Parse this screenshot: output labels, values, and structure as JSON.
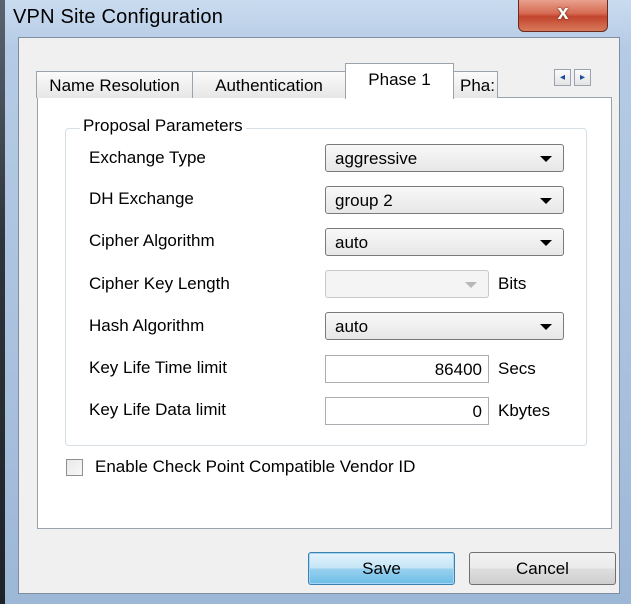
{
  "window": {
    "title": "VPN Site Configuration",
    "close_glyph": "x"
  },
  "tabs": [
    {
      "label": "Name Resolution"
    },
    {
      "label": "Authentication"
    },
    {
      "label": "Phase 1",
      "active": true
    },
    {
      "label": "Pha:"
    }
  ],
  "tab_scroll": {
    "left_icon": "scroll-left-icon",
    "right_icon": "scroll-right-icon"
  },
  "group": {
    "title": "Proposal Parameters"
  },
  "fields": {
    "exchange_type": {
      "label": "Exchange Type",
      "value": "aggressive"
    },
    "dh_exchange": {
      "label": "DH Exchange",
      "value": "group 2"
    },
    "cipher_algorithm": {
      "label": "Cipher Algorithm",
      "value": "auto"
    },
    "cipher_key_length": {
      "label": "Cipher Key Length",
      "value": "",
      "unit": "Bits",
      "disabled": true
    },
    "hash_algorithm": {
      "label": "Hash Algorithm",
      "value": "auto"
    },
    "key_life_time": {
      "label": "Key Life Time limit",
      "value": "86400",
      "unit": "Secs"
    },
    "key_life_data": {
      "label": "Key Life Data limit",
      "value": "0",
      "unit": "Kbytes"
    }
  },
  "vendor_id_checkbox": {
    "label": "Enable Check Point Compatible Vendor ID",
    "checked": false
  },
  "buttons": {
    "save": "Save",
    "cancel": "Cancel"
  },
  "colors": {
    "close_button": "#c2442c",
    "default_button": "#6cbde6"
  }
}
